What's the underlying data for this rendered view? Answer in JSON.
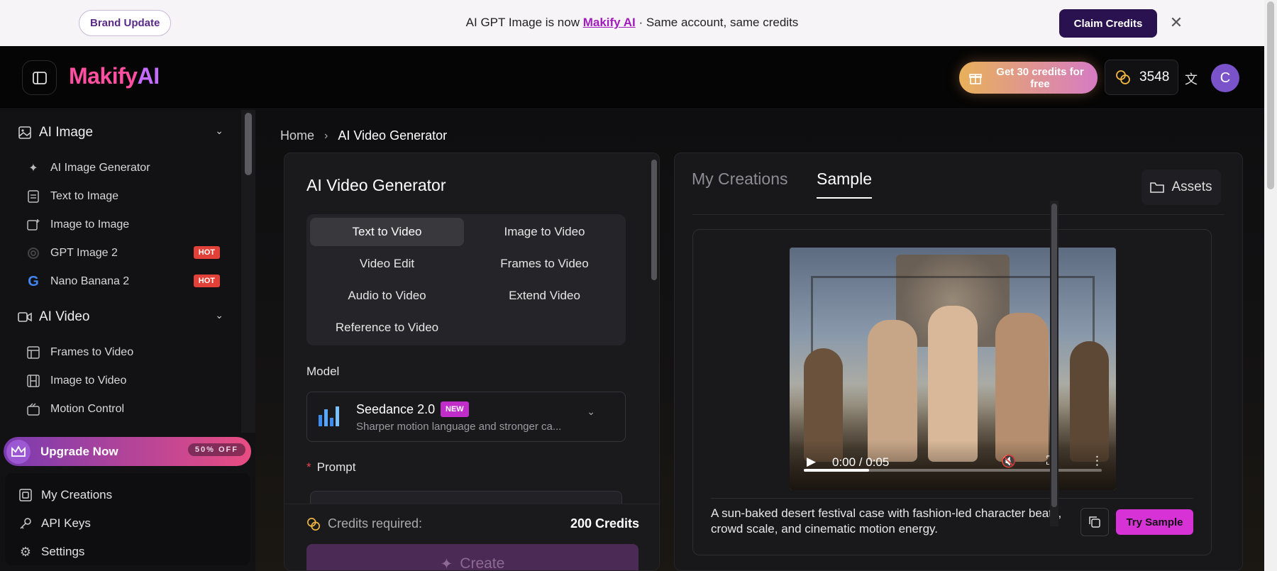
{
  "banner": {
    "brand_pill": "Brand Update",
    "message_pre": "AI GPT Image is now ",
    "message_link": "Makify AI",
    "message_post": " · Same account, same credits",
    "claim_button": "Claim Credits",
    "close_icon": "close-icon"
  },
  "header": {
    "logo_main": "Makify",
    "logo_ai": "AI",
    "promo": "Get 30 credits for free",
    "credit_balance": "3548",
    "avatar_letter": "C"
  },
  "sidebar": {
    "sections": [
      {
        "label": "AI Image",
        "icon": "image-icon"
      },
      {
        "label": "AI Video",
        "icon": "video-icon"
      }
    ],
    "image_items": [
      {
        "label": "AI Image Generator",
        "icon": "sparkle-icon"
      },
      {
        "label": "Text to Image",
        "icon": "document-icon"
      },
      {
        "label": "Image to Image",
        "icon": "image-edit-icon"
      },
      {
        "label": "GPT Image 2",
        "icon": "openai-icon",
        "badge": "HOT"
      },
      {
        "label": "Nano Banana 2",
        "icon": "google-icon",
        "badge": "HOT"
      }
    ],
    "video_items": [
      {
        "label": "Frames to Video",
        "icon": "frames-icon"
      },
      {
        "label": "Image to Video",
        "icon": "film-icon"
      },
      {
        "label": "Motion Control",
        "icon": "camera-icon"
      }
    ],
    "upgrade": {
      "label": "Upgrade Now",
      "discount": "50% OFF"
    },
    "bottom_items": [
      {
        "label": "My Creations",
        "icon": "gallery-icon"
      },
      {
        "label": "API Keys",
        "icon": "key-icon"
      },
      {
        "label": "Settings",
        "icon": "gear-icon"
      }
    ]
  },
  "breadcrumb": {
    "home": "Home",
    "current": "AI Video Generator"
  },
  "generator": {
    "title": "AI Video Generator",
    "modes": [
      "Text to Video",
      "Image to Video",
      "Video Edit",
      "Frames to Video",
      "Audio to Video",
      "Extend Video",
      "Reference to Video"
    ],
    "active_mode": "Text to Video",
    "model_label": "Model",
    "model_name": "Seedance 2.0",
    "model_badge": "NEW",
    "model_desc": "Sharper motion language and stronger ca...",
    "prompt_label": "Prompt",
    "prompt_required": "*",
    "credits_label": "Credits required:",
    "credits_amount": "200 Credits",
    "create_button": "Create"
  },
  "results": {
    "tabs": [
      "My Creations",
      "Sample"
    ],
    "active_tab": "Sample",
    "assets_button": "Assets",
    "video": {
      "time": "0:00 / 0:05",
      "progress": 0.22
    },
    "caption": "A sun-baked desert festival case with fashion-led character beats, crowd scale, and cinematic motion energy.",
    "try_button": "Try Sample"
  },
  "colors": {
    "accent": "#d632d6",
    "claim": "#2a1150",
    "hot": "#e2413a"
  }
}
